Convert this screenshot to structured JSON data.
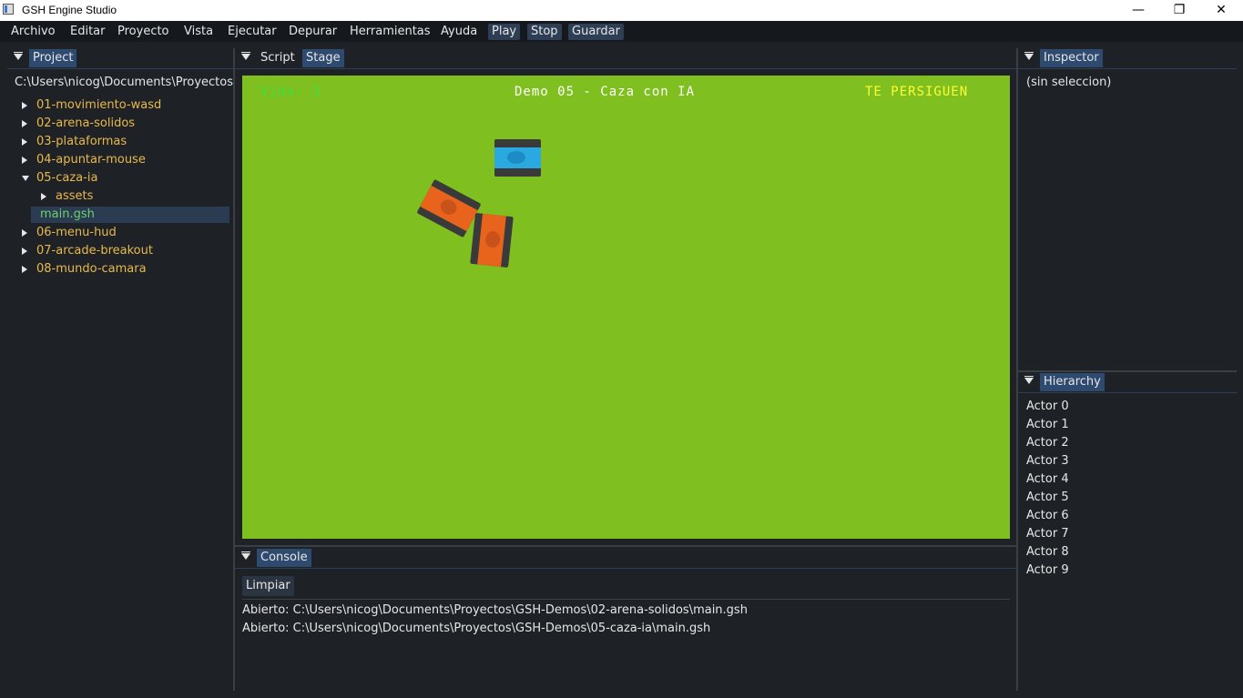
{
  "window": {
    "title": "GSH Engine Studio",
    "minimize": "—",
    "restore": "❐",
    "close": "✕"
  },
  "menu": {
    "items": [
      "Archivo",
      "Editar",
      "Proyecto",
      "Vista",
      "Ejecutar",
      "Depurar",
      "Herramientas",
      "Ayuda"
    ],
    "play": "Play",
    "stop": "Stop",
    "save": "Guardar"
  },
  "project": {
    "tab": "Project",
    "path": "C:\\Users\\nicog\\Documents\\Proyectos\\",
    "tree": [
      {
        "label": "01-movimiento-wasd"
      },
      {
        "label": "02-arena-solidos"
      },
      {
        "label": "03-plataformas"
      },
      {
        "label": "04-apuntar-mouse"
      },
      {
        "label": "05-caza-ia"
      },
      {
        "label": "assets"
      },
      {
        "label": "main.gsh"
      },
      {
        "label": "06-menu-hud"
      },
      {
        "label": "07-arcade-breakout"
      },
      {
        "label": "08-mundo-camara"
      }
    ]
  },
  "center": {
    "tab_script": "Script",
    "tab_stage": "Stage"
  },
  "stage": {
    "hud_life": "Vida: 3",
    "hud_title": "Demo 05 - Caza con IA",
    "hud_status": "TE PERSIGUEN",
    "colors": {
      "ground": "#7fbf1f",
      "player": "#29a9e0",
      "enemy": "#e8641c",
      "track": "#3a3a3a"
    }
  },
  "console": {
    "tab": "Console",
    "clear_button": "Limpiar",
    "lines": [
      "Abierto: C:\\Users\\nicog\\Documents\\Proyectos\\GSH-Demos\\02-arena-solidos\\main.gsh",
      "Abierto: C:\\Users\\nicog\\Documents\\Proyectos\\GSH-Demos\\05-caza-ia\\main.gsh"
    ]
  },
  "inspector": {
    "tab": "Inspector",
    "empty": "(sin seleccion)"
  },
  "hierarchy": {
    "tab": "Hierarchy",
    "actors": [
      "Actor 0",
      "Actor 1",
      "Actor 2",
      "Actor 3",
      "Actor 4",
      "Actor 5",
      "Actor 6",
      "Actor 7",
      "Actor 8",
      "Actor 9"
    ]
  }
}
